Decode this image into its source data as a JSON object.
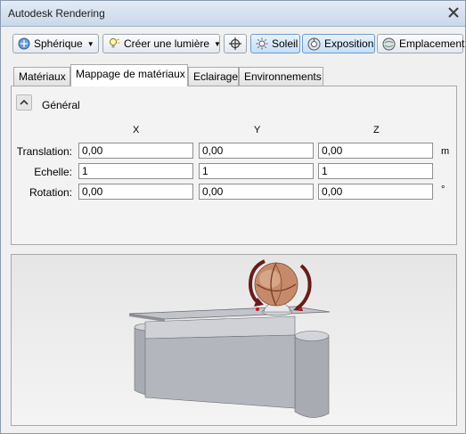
{
  "window": {
    "title": "Autodesk Rendering"
  },
  "toolbar": {
    "spherique_label": "Sphérique",
    "creer_lumiere_label": "Créer une lumière",
    "soleil_label": "Soleil",
    "exposition_label": "Exposition",
    "emplacement_label": "Emplacement"
  },
  "tabs": [
    {
      "label": "Matériaux"
    },
    {
      "label": "Mappage de matériaux"
    },
    {
      "label": "Eclairage"
    },
    {
      "label": "Environnements"
    }
  ],
  "general": {
    "section_title": "Général",
    "columns": [
      "X",
      "Y",
      "Z"
    ],
    "rows": [
      {
        "label": "Translation:",
        "values": [
          "0,00",
          "0,00",
          "0,00"
        ],
        "unit": "m"
      },
      {
        "label": "Echelle:",
        "values": [
          "1",
          "1",
          "1"
        ],
        "unit": ""
      },
      {
        "label": "Rotation:",
        "values": [
          "0,00",
          "0,00",
          "0,00"
        ],
        "unit": "°"
      }
    ]
  },
  "colors": {
    "accent": "#c5dff7",
    "preview_object": "#b4b6bd",
    "sphere": "#c58a6a"
  }
}
